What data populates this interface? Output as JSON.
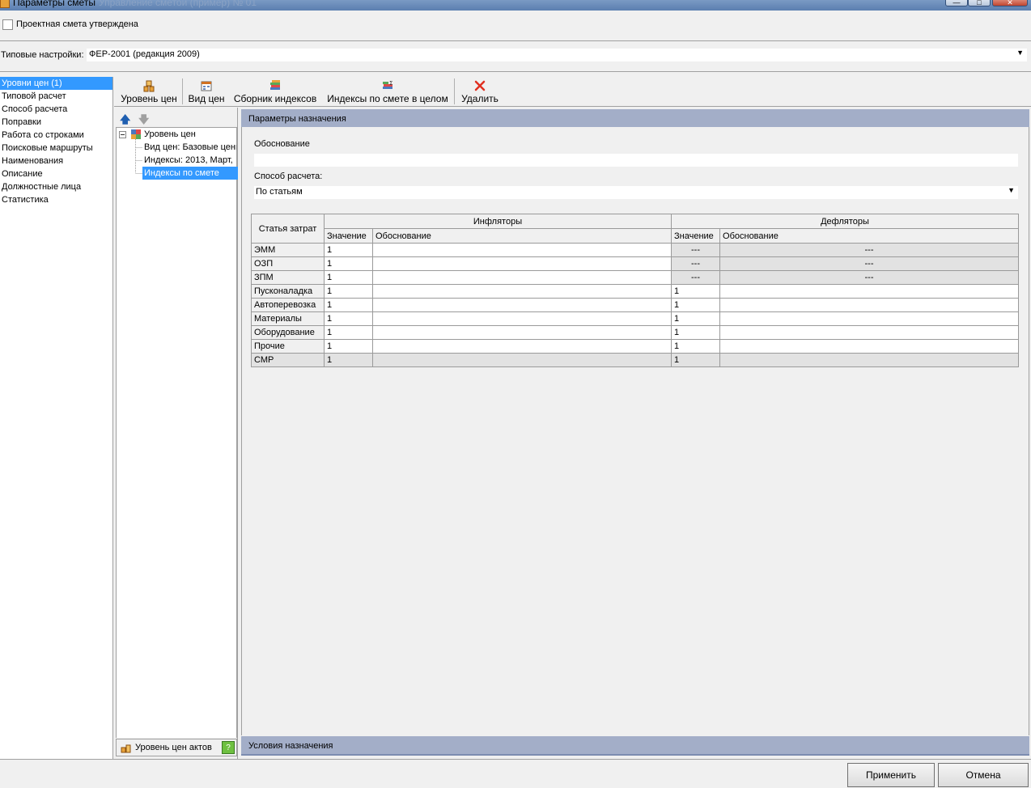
{
  "window": {
    "title": "Параметры сметы",
    "title_ghost": "Управление сметой (пример) № 01",
    "minimize_label": "—",
    "maximize_label": "□",
    "close_label": "✕"
  },
  "approved_checkbox": {
    "label": "Проектная смета утверждена",
    "checked": false
  },
  "typical_settings": {
    "label": "Типовые настройки:",
    "value": "ФЕР-2001 (редакция 2009)"
  },
  "nav": {
    "items": [
      {
        "label": "Уровни цен (1)",
        "selected": true
      },
      {
        "label": "Типовой расчет"
      },
      {
        "label": "Способ расчета"
      },
      {
        "label": "Поправки"
      },
      {
        "label": "Работа со строками"
      },
      {
        "label": "Поисковые маршруты"
      },
      {
        "label": "Наименования"
      },
      {
        "label": "Описание"
      },
      {
        "label": "Должностные лица"
      },
      {
        "label": "Статистика"
      }
    ]
  },
  "toolbar": {
    "price_level": "Уровень цен",
    "price_kind": "Вид цен",
    "index_collection": "Сборник индексов",
    "estimate_indexes": "Индексы по смете в целом",
    "delete": "Удалить"
  },
  "tree": {
    "root": "Уровень цен",
    "children": [
      "Вид цен: Базовые цены",
      "Индексы: 2013, Март,",
      "Индексы по смете"
    ],
    "acts_button": "Уровень цен актов"
  },
  "assignment_params": {
    "header": "Параметры назначения",
    "justification_label": "Обоснование",
    "justification_value": "",
    "calc_method_label": "Способ расчета:",
    "calc_method_value": "По статьям"
  },
  "grid": {
    "col_article": "Статья затрат",
    "inflators": "Инфляторы",
    "deflators": "Дефляторы",
    "col_value": "Значение",
    "col_basis": "Обоснование",
    "rows": [
      {
        "name": "ЭММ",
        "infl_value": "1",
        "infl_basis": "",
        "defl_value": "---",
        "defl_basis": "---",
        "defl_disabled": true
      },
      {
        "name": "ОЗП",
        "infl_value": "1",
        "infl_basis": "",
        "defl_value": "---",
        "defl_basis": "---",
        "defl_disabled": true
      },
      {
        "name": "ЗПМ",
        "infl_value": "1",
        "infl_basis": "",
        "defl_value": "---",
        "defl_basis": "---",
        "defl_disabled": true
      },
      {
        "name": "Пусконаладка",
        "infl_value": "1",
        "infl_basis": "",
        "defl_value": "1",
        "defl_basis": ""
      },
      {
        "name": "Автоперевозка",
        "infl_value": "1",
        "infl_basis": "",
        "defl_value": "1",
        "defl_basis": ""
      },
      {
        "name": "Материалы",
        "infl_value": "1",
        "infl_basis": "",
        "defl_value": "1",
        "defl_basis": ""
      },
      {
        "name": "Оборудование",
        "infl_value": "1",
        "infl_basis": "",
        "defl_value": "1",
        "defl_basis": ""
      },
      {
        "name": "Прочие",
        "infl_value": "1",
        "infl_basis": "",
        "defl_value": "1",
        "defl_basis": ""
      },
      {
        "name": "СМР",
        "infl_value": "1",
        "infl_basis": "",
        "defl_value": "1",
        "defl_basis": "",
        "all_disabled": true
      }
    ]
  },
  "conditions": {
    "header": "Условия назначения"
  },
  "buttons": {
    "apply": "Применить",
    "cancel": "Отмена"
  },
  "colors": {
    "selection": "#3399ff",
    "section_header": "#a3aec8",
    "delete_icon": "#e03020"
  }
}
